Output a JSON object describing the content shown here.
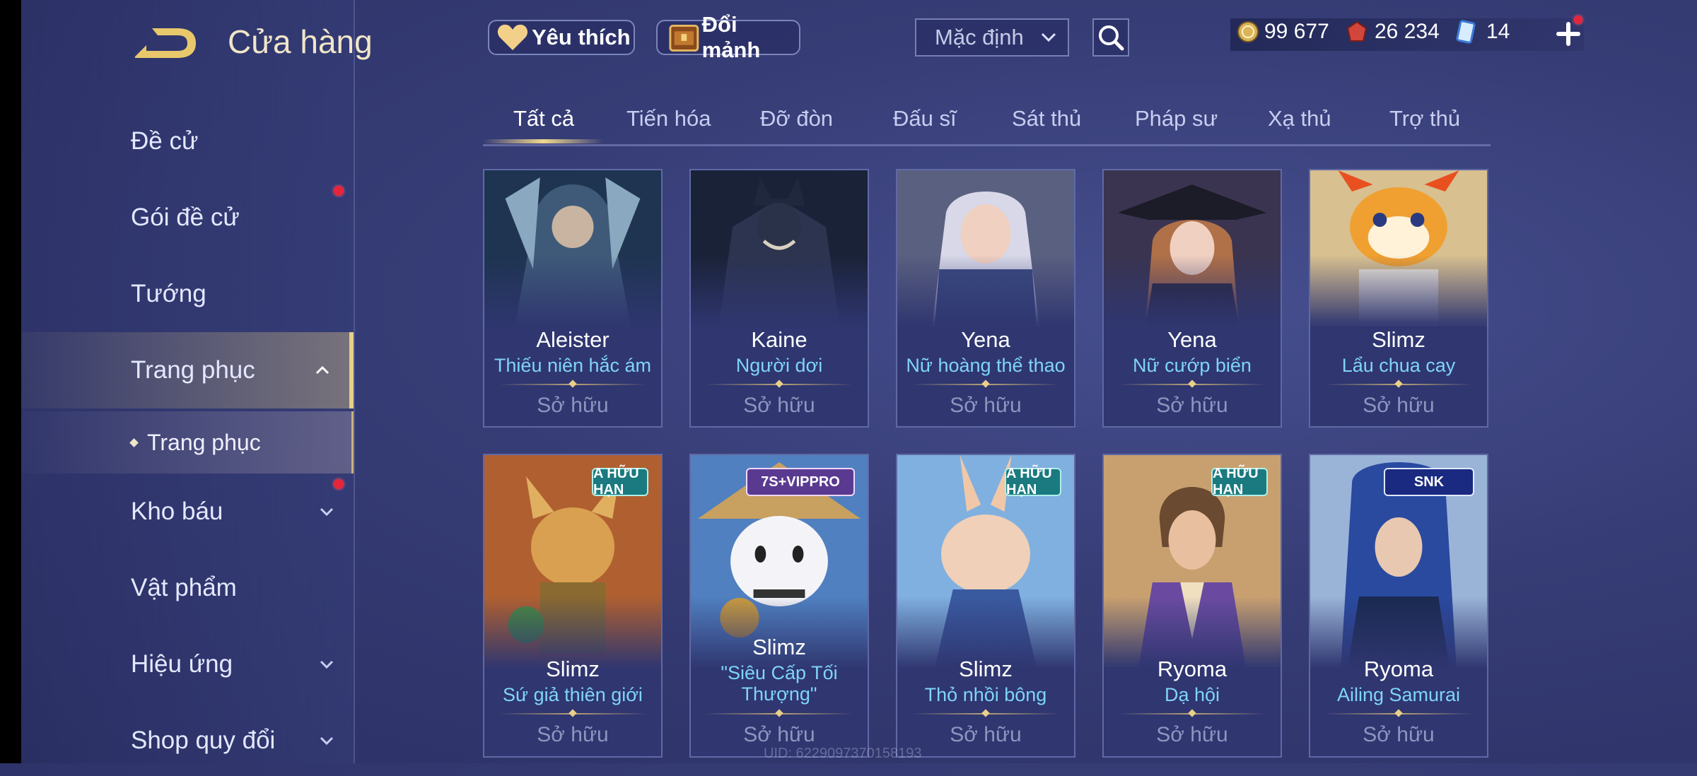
{
  "header": {
    "title": "Cửa hàng"
  },
  "sidebar": {
    "items": [
      {
        "label": "Đề cử"
      },
      {
        "label": "Gói đề cử"
      },
      {
        "label": "Tướng"
      },
      {
        "label": "Trang phục"
      },
      {
        "label": "Kho báu"
      },
      {
        "label": "Vật phẩm"
      },
      {
        "label": "Hiệu ứng"
      },
      {
        "label": "Shop quy đổi"
      }
    ],
    "sub_item": {
      "label": "Trang phục"
    }
  },
  "toolbar": {
    "favorite_label": "Yêu thích",
    "exchange_label": "Đổi mảnh",
    "sort_value": "Mặc định"
  },
  "currency": {
    "gold": "99 677",
    "vouchers": "26 234",
    "tokens": "14"
  },
  "tabs": [
    {
      "label": "Tất cả"
    },
    {
      "label": "Tiến hóa"
    },
    {
      "label": "Đỡ đòn"
    },
    {
      "label": "Đấu sĩ"
    },
    {
      "label": "Sát thủ"
    },
    {
      "label": "Pháp sư"
    },
    {
      "label": "Xạ thủ"
    },
    {
      "label": "Trợ thủ"
    }
  ],
  "cards": [
    {
      "hero": "Aleister",
      "skin": "Thiếu niên hắc ám",
      "status": "Sở hữu"
    },
    {
      "hero": "Kaine",
      "skin": "Người dơi",
      "status": "Sở hữu"
    },
    {
      "hero": "Yena",
      "skin": "Nữ hoàng thể thao",
      "status": "Sở hữu"
    },
    {
      "hero": "Yena",
      "skin": "Nữ cướp biển",
      "status": "Sở hữu"
    },
    {
      "hero": "Slimz",
      "skin": "Lẩu chua cay",
      "status": "Sở hữu"
    },
    {
      "hero": "Slimz",
      "skin": "Sứ giả thiên giới",
      "status": "Sở hữu",
      "badge": "A HỮU HẠN"
    },
    {
      "hero": "Slimz",
      "skin_line1": "\"Siêu Cấp Tối",
      "skin_line2": "Thượng\"",
      "status": "Sở hữu",
      "badge": "7S+VIPPRO"
    },
    {
      "hero": "Slimz",
      "skin": "Thỏ nhồi bông",
      "status": "Sở hữu",
      "badge": "A HỮU HẠN"
    },
    {
      "hero": "Ryoma",
      "skin": "Dạ hội",
      "status": "Sở hữu",
      "badge": "A HỮU HẠN"
    },
    {
      "hero": "Ryoma",
      "skin": "Ailing Samurai",
      "status": "Sở hữu",
      "badge": "SNK"
    }
  ],
  "footer": {
    "uid": "UID: 6229097370158193"
  },
  "colors": {
    "accent_gold": "#e6d08a",
    "skin_name": "#7fd4f8",
    "notify_red": "#e8243a"
  }
}
